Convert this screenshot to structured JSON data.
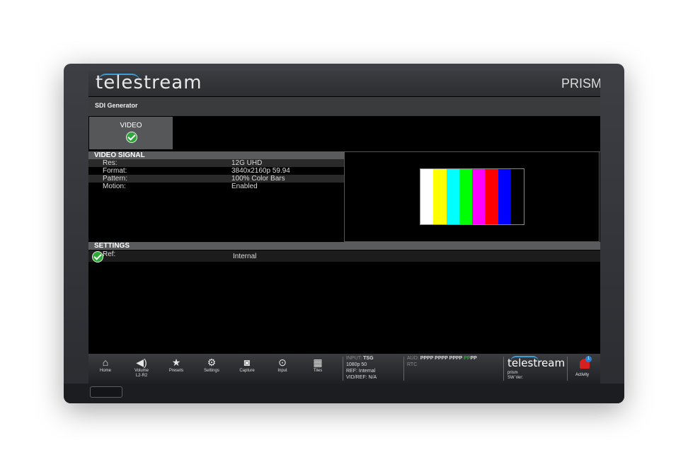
{
  "brand": {
    "logo": "telestream",
    "product": "PRISM"
  },
  "page": {
    "title": "SDI Generator"
  },
  "tabs": [
    {
      "label": "VIDEO",
      "status": "ok"
    }
  ],
  "video_signal": {
    "header": "VIDEO SIGNAL",
    "rows": [
      {
        "label": "Res:",
        "value": "12G UHD"
      },
      {
        "label": "Format:",
        "value": "3840x2160p 59.94"
      },
      {
        "label": "Pattern:",
        "value": "100% Color Bars"
      },
      {
        "label": "Motion:",
        "value": "Enabled"
      }
    ]
  },
  "preview": {
    "bar_colors": [
      "#ffffff",
      "#ffff00",
      "#00ffff",
      "#00ff00",
      "#ff00ff",
      "#ff0000",
      "#0000ff",
      "#000000"
    ]
  },
  "settings": {
    "header": "SETTINGS",
    "rows": [
      {
        "label": "Ref:",
        "value": "Internal",
        "status": "ok"
      }
    ]
  },
  "taskbar": {
    "buttons": [
      {
        "icon": "home-icon",
        "label": "Home",
        "sub": ""
      },
      {
        "icon": "volume-icon",
        "label": "Volume",
        "sub": "L2-R2"
      },
      {
        "icon": "star-icon",
        "label": "Presets",
        "sub": ""
      },
      {
        "icon": "gear-icon",
        "label": "Settings",
        "sub": ""
      },
      {
        "icon": "camera-icon",
        "label": "Capture",
        "sub": ""
      },
      {
        "icon": "input-icon",
        "label": "Input",
        "sub": ""
      },
      {
        "icon": "tiles-icon",
        "label": "Tiles",
        "sub": ""
      }
    ],
    "input": {
      "label": "INPUT:",
      "value": "TSG",
      "line2": "1080p 50",
      "ref": "REF: Internal",
      "vidref_label": "VID/REF:",
      "vidref_value": "N/A"
    },
    "audio": {
      "label": "AUD:",
      "value_main": "PPPP PPPP PPPP ",
      "value_green": "PP",
      "value_tail": "PP",
      "rtc": "RTC"
    },
    "product": {
      "logo": "telestream",
      "name": "prism",
      "sw": "SW Ver:"
    },
    "activity": {
      "label": "Activity",
      "badge": "1"
    }
  },
  "colors": {
    "accent_green": "#2fa83a",
    "brand_blue": "#3a9fd8",
    "alert_red": "#d62020"
  }
}
